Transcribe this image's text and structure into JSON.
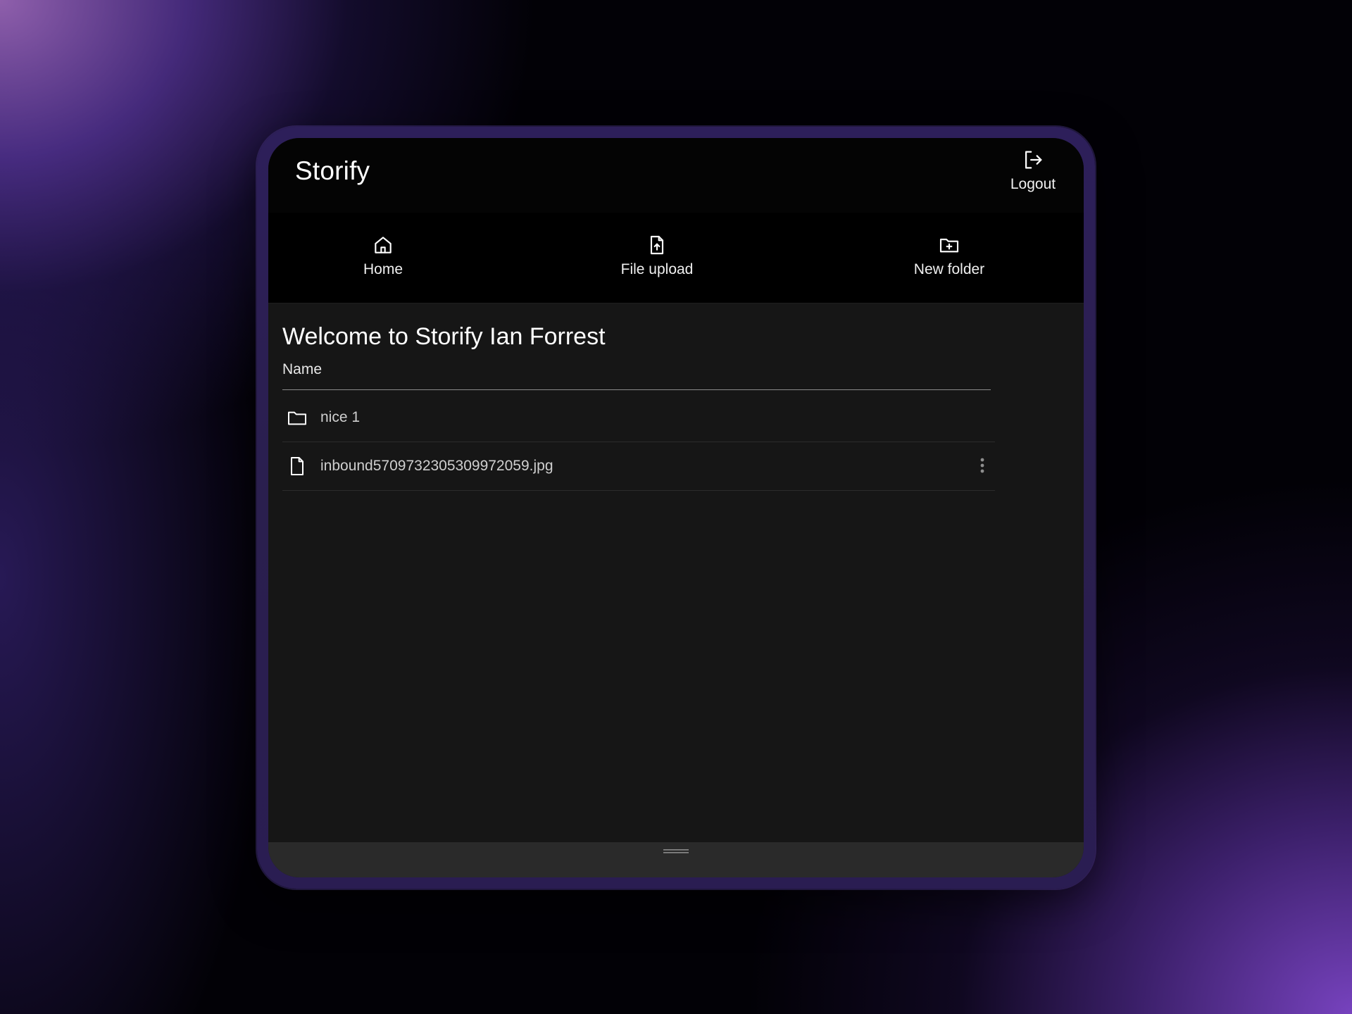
{
  "app": {
    "title": "Storify"
  },
  "header": {
    "logout_label": "Logout",
    "logout_icon": "logout-icon"
  },
  "nav": {
    "items": [
      {
        "label": "Home",
        "icon": "home-icon"
      },
      {
        "label": "File upload",
        "icon": "file-upload-icon"
      },
      {
        "label": "New folder",
        "icon": "new-folder-icon"
      }
    ]
  },
  "main": {
    "welcome": "Welcome to Storify Ian Forrest",
    "column_header": "Name",
    "items": [
      {
        "name": "nice 1",
        "type": "folder",
        "icon": "folder-icon"
      },
      {
        "name": "inbound5709732305309972059.jpg",
        "type": "file",
        "icon": "file-icon"
      }
    ]
  },
  "colors": {
    "background_purple": "#7a45c8",
    "frame": "#2b1f55",
    "screen_bg": "#161616",
    "appbar_bg": "#040404",
    "text_primary": "#ffffff",
    "text_secondary": "#cfcfcf"
  }
}
